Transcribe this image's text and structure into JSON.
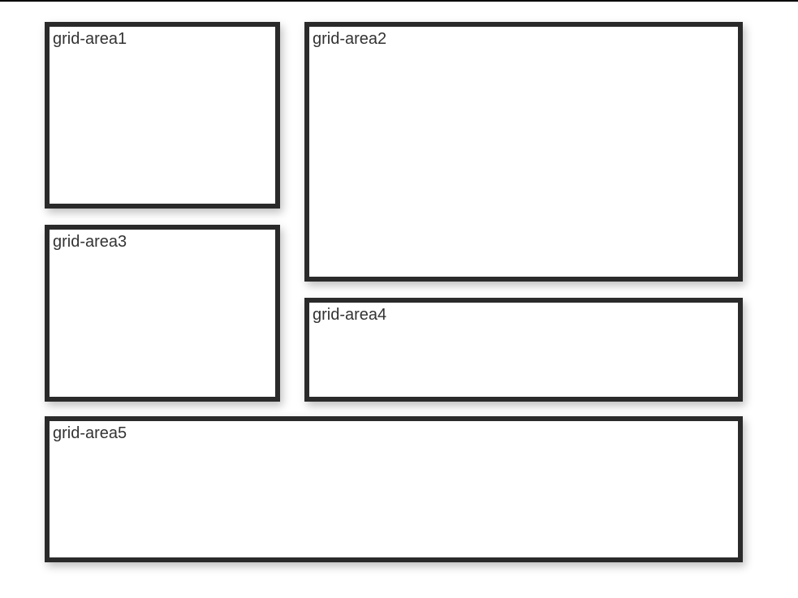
{
  "grid": {
    "area1": {
      "label": "grid-area1"
    },
    "area2": {
      "label": "grid-area2"
    },
    "area3": {
      "label": "grid-area3"
    },
    "area4": {
      "label": "grid-area4"
    },
    "area5": {
      "label": "grid-area5"
    }
  }
}
